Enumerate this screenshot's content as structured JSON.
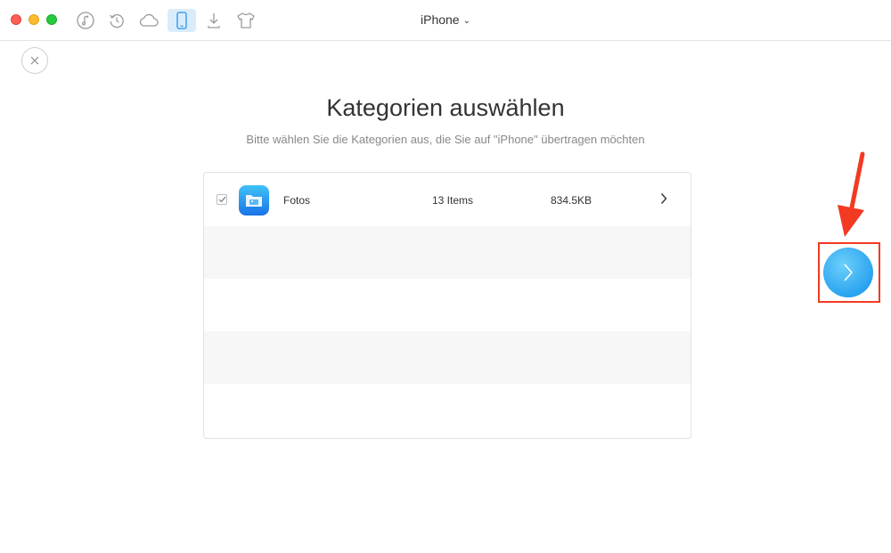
{
  "window": {
    "title": "iPhone",
    "toolbar_icons": [
      "music-icon",
      "restore-icon",
      "cloud-icon",
      "iphone-icon",
      "download-icon",
      "tshirt-icon"
    ],
    "active_icon": "iphone-icon"
  },
  "page": {
    "heading": "Kategorien auswählen",
    "subheading": "Bitte wählen Sie die Kategorien aus, die Sie auf  \"iPhone\" übertragen möchten"
  },
  "categories": [
    {
      "name": "Fotos",
      "count": "13 Items",
      "size": "834.5KB",
      "checked": true
    }
  ],
  "colors": {
    "accent": "#2aa3f0",
    "highlight": "#f23a22",
    "active_tab_bg": "#d9ecfb"
  }
}
